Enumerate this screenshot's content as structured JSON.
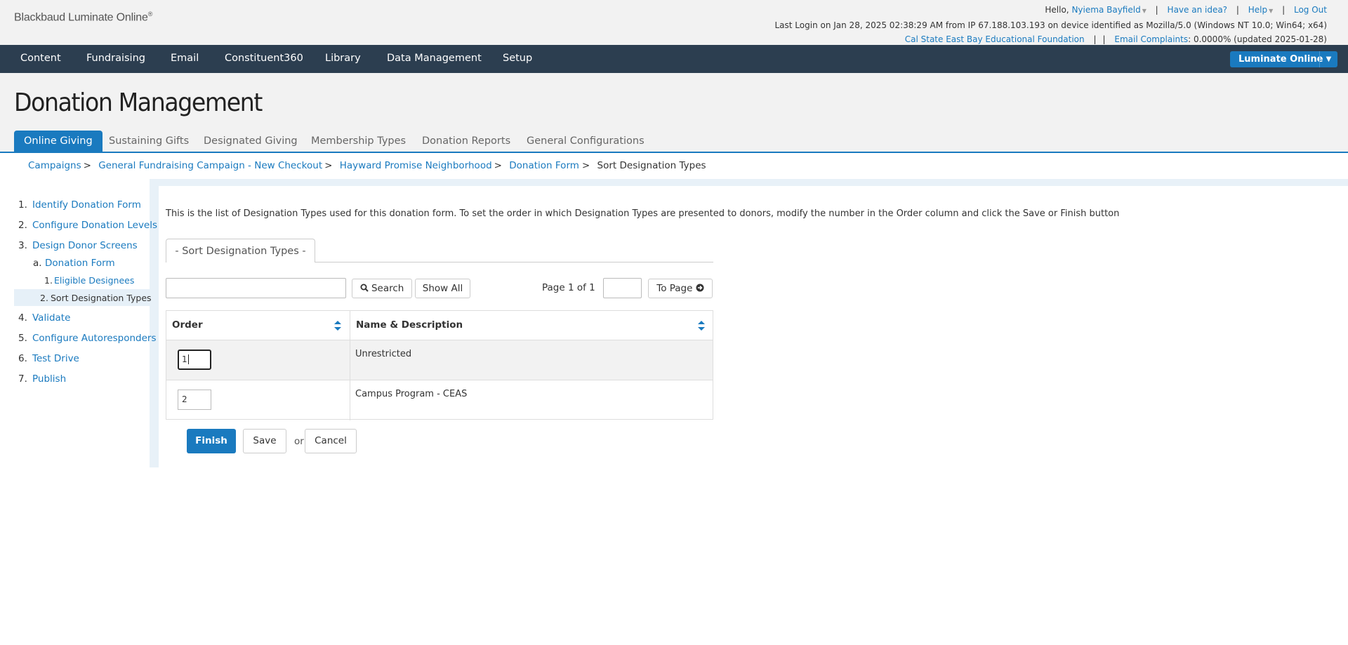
{
  "header": {
    "logo": "Blackbaud Luminate Online",
    "logo_mark": "®",
    "greeting": "Hello,",
    "user_name": "Nyiema Bayfield",
    "have_idea": "Have an idea?",
    "help": "Help",
    "logout": "Log Out",
    "last_login": "Last Login on Jan 28, 2025 02:38:29 AM from IP 67.188.103.193 on device identified as Mozilla/5.0 (Windows NT 10.0; Win64; x64)",
    "org_name": "Cal State East Bay Educational Foundation",
    "complaints_label": "Email Complaints",
    "complaints_value": ": 0.0000% (updated 2025-01-28)"
  },
  "topnav": {
    "items": [
      "Content",
      "Fundraising",
      "Email",
      "Constituent360",
      "Library",
      "Data Management",
      "Setup"
    ],
    "product_button": "Luminate Online"
  },
  "page": {
    "title": "Donation Management",
    "tabs": [
      "Online Giving",
      "Sustaining Gifts",
      "Designated Giving",
      "Membership Types",
      "Donation Reports",
      "General Configurations"
    ]
  },
  "breadcrumb": {
    "items": [
      "Campaigns",
      "General Fundraising Campaign - New Checkout",
      "Hayward Promise Neighborhood",
      "Donation Form"
    ],
    "current": "Sort Designation Types",
    "separator": ">"
  },
  "sidebar": {
    "steps": [
      {
        "num": "1.",
        "label": "Identify Donation Form"
      },
      {
        "num": "2.",
        "label": "Configure Donation Levels"
      },
      {
        "num": "3.",
        "label": "Design Donor Screens"
      },
      {
        "num": "a.",
        "label": "Donation Form"
      },
      {
        "num": "1.",
        "label": "Eligible Designees"
      },
      {
        "num": "2.",
        "label": "Sort Designation Types"
      },
      {
        "num": "4.",
        "label": "Validate"
      },
      {
        "num": "5.",
        "label": "Configure Autoresponders"
      },
      {
        "num": "6.",
        "label": "Test Drive"
      },
      {
        "num": "7.",
        "label": "Publish"
      }
    ]
  },
  "main": {
    "description": "This is the list of Designation Types used for this donation form. To set the order in which Designation Types are presented to donors, modify the number in the Order column and click the Save or Finish button",
    "inner_tab": "- Sort Designation Types -",
    "search_value": "",
    "search_button": "Search",
    "show_all_button": "Show All",
    "page_info": "Page 1 of 1",
    "page_input_value": "",
    "to_page_button": "To Page",
    "columns": [
      "Order",
      "Name & Description"
    ],
    "rows": [
      {
        "order": "1",
        "name": "Unrestricted"
      },
      {
        "order": "2",
        "name": "Campus Program - CEAS"
      }
    ],
    "finish_button": "Finish",
    "save_button": "Save",
    "or_text": "or",
    "cancel_button": "Cancel"
  },
  "colors": {
    "accent": "#1a7abf",
    "nav_bg": "#2c3e50",
    "header_bg": "#f2f2f2"
  }
}
